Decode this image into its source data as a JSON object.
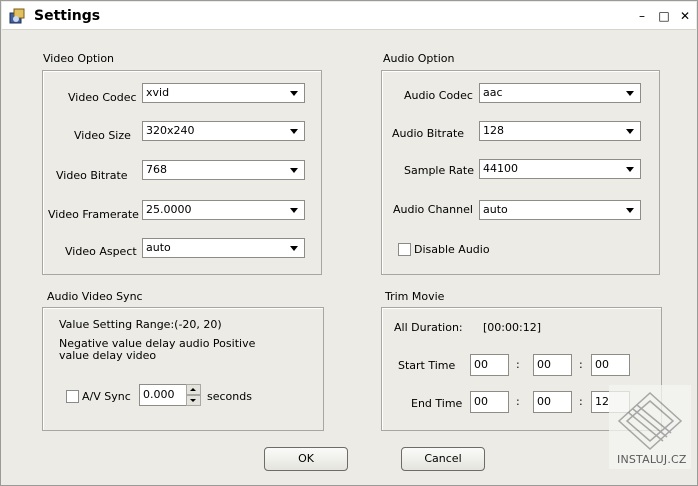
{
  "window": {
    "title": "Settings",
    "minimize_icon": "minimize-icon",
    "maximize_icon": "maximize-icon",
    "close_icon": "close-icon"
  },
  "video": {
    "group_title": "Video Option",
    "codec": {
      "label": "Video Codec",
      "value": "xvid"
    },
    "size": {
      "label": "Video Size",
      "value": "320x240"
    },
    "bitrate": {
      "label": "Video Bitrate",
      "value": "768"
    },
    "framerate": {
      "label": "Video Framerate",
      "value": "25.0000"
    },
    "aspect": {
      "label": "Video Aspect",
      "value": "auto"
    }
  },
  "audio": {
    "group_title": "Audio Option",
    "codec": {
      "label": "Audio Codec",
      "value": "aac"
    },
    "bitrate": {
      "label": "Audio Bitrate",
      "value": "128"
    },
    "sample_rate": {
      "label": "Sample Rate",
      "value": "44100"
    },
    "channel": {
      "label": "Audio Channel",
      "value": "auto"
    },
    "disable": {
      "label": "Disable Audio",
      "checked": false
    }
  },
  "sync": {
    "group_title": "Audio Video Sync",
    "range_text": "Value Setting Range:(-20, 20)",
    "desc_line1": "Negative value delay audio Positive",
    "desc_line2": "value delay video",
    "av_sync_label": "A/V Sync",
    "av_sync_checked": false,
    "value": "0.000",
    "unit": "seconds"
  },
  "trim": {
    "group_title": "Trim Movie",
    "all_duration_label": "All Duration:",
    "all_duration_value": "[00:00:12]",
    "start_label": "Start Time",
    "start": [
      "00",
      "00",
      "00"
    ],
    "end_label": "End Time",
    "end": [
      "00",
      "00",
      "12"
    ],
    "separator": ":"
  },
  "buttons": {
    "ok": "OK",
    "cancel": "Cancel"
  },
  "watermark": {
    "text": "INSTALUJ.CZ"
  }
}
